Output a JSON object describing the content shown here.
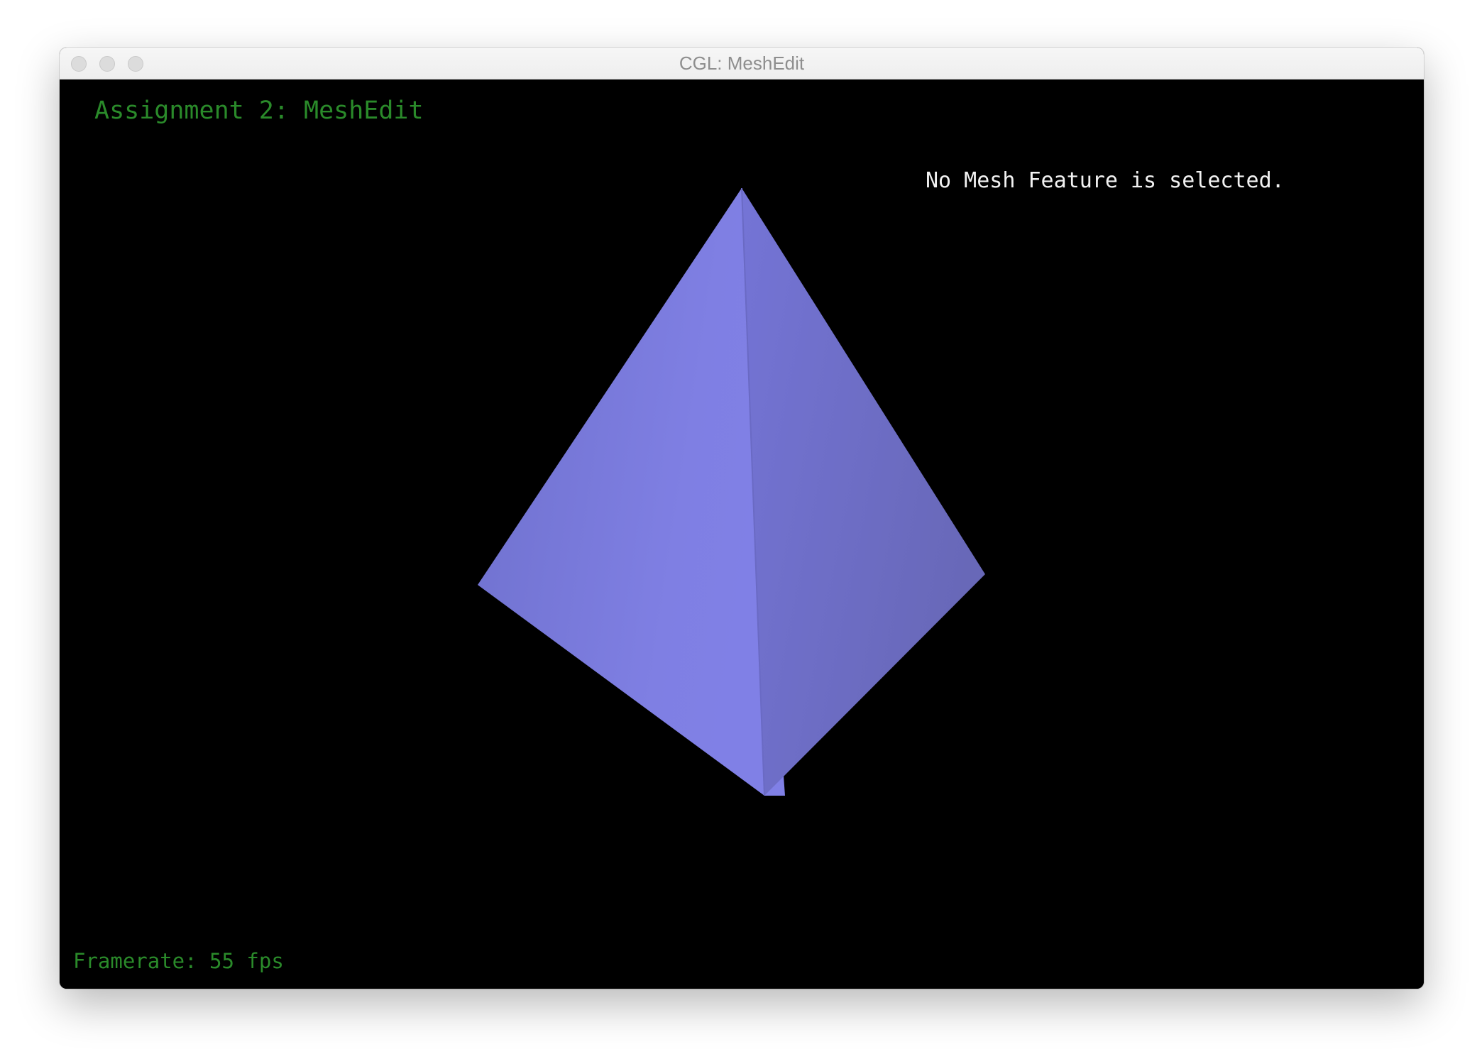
{
  "window": {
    "title": "CGL: MeshEdit"
  },
  "viewport": {
    "heading": "Assignment 2: MeshEdit",
    "selection_status": "No Mesh Feature is selected.",
    "framerate": "Framerate: 55 fps"
  },
  "colors": {
    "background": "#000000",
    "overlay_text_green": "#2a8a2a",
    "status_text": "#f2f2f2",
    "mesh_face_left": "#7b7ddf",
    "mesh_face_right": "#6f71cc"
  },
  "icons": {
    "close": "traffic-light-close-icon",
    "minimize": "traffic-light-minimize-icon",
    "maximize": "traffic-light-maximize-icon"
  }
}
